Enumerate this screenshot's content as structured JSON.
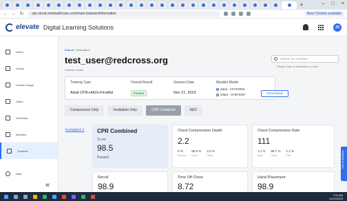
{
  "browser": {
    "url": "cpe.cloud.zoehealthcare.com/main-trainees/information",
    "profile_label": "New Chrome available",
    "window_controls": [
      "–",
      "□",
      "×"
    ]
  },
  "header": {
    "logo_text": "elevate",
    "app_title": "Digital Learning Solutions",
    "avatar_initials": "JD"
  },
  "sidebar": {
    "items": [
      {
        "label": "Home",
        "icon": "home-icon"
      },
      {
        "label": "Library",
        "icon": "library-icon"
      },
      {
        "label": "Learner usage",
        "icon": "document-icon"
      },
      {
        "label": "Users",
        "icon": "users-icon"
      },
      {
        "label": "Summary",
        "icon": "summary-icon"
      },
      {
        "label": "Modules",
        "icon": "modules-icon"
      },
      {
        "label": "Trainees",
        "icon": "trainees-icon"
      }
    ],
    "help_label": "Help",
    "collapse_glyph": "«"
  },
  "main": {
    "breadcrumb_search": "Search",
    "breadcrumb_rest": " / Information",
    "user_email": "test_user@redcross.org",
    "session_results": "Session results",
    "search_placeholder": "Search for a trainee",
    "search_hint": "Please enter 3 characters or more",
    "info": {
      "training_type_h": "Training Type",
      "overall_result_h": "Overall Result",
      "session_date_h": "Session Date",
      "manikin_model_h": "Manikin Model",
      "training_type": "Adult CPR+AED+FirstAid",
      "overall_result": "Passed",
      "session_date": "Nov 21, 2023",
      "manikin_adult": "adult - CFAF0006",
      "manikin_infant": "infant - CFBF0007"
    },
    "all_sessions": "All Sessions",
    "tabs": [
      "Compression Only",
      "Ventilation Only",
      "CPR Combined",
      "AED"
    ],
    "evaluation_link": "Evaluation 1",
    "cpr": {
      "title": "CPR Combined",
      "score_label": "Score",
      "score": "98.5",
      "status": "Passed"
    },
    "depth": {
      "title": "Chest Compression Depth",
      "value": "2.2",
      "stats": [
        {
          "v": "0 %",
          "l": "Shallow"
        },
        {
          "v": "95.6 %",
          "l": "Good"
        },
        {
          "v": "3.3 %",
          "l": "Deep"
        }
      ]
    },
    "rate": {
      "title": "Chest Compression Rate",
      "value": "111",
      "stats": [
        {
          "v": "1.1 %",
          "l": "Slow"
        },
        {
          "v": "96.7 %",
          "l": "Good"
        },
        {
          "v": "1.1 %",
          "l": "Fast"
        }
      ]
    },
    "recoil": {
      "title": "Recoil",
      "value": "98.9"
    },
    "time_off": {
      "title": "Time Off Chest",
      "value": "8.72"
    },
    "hand": {
      "title": "Hand Placement",
      "value": "98.9"
    },
    "side_tab": "Give us feedback"
  },
  "taskbar": {
    "time": "7:41 AM",
    "date": "11/21/2023"
  }
}
